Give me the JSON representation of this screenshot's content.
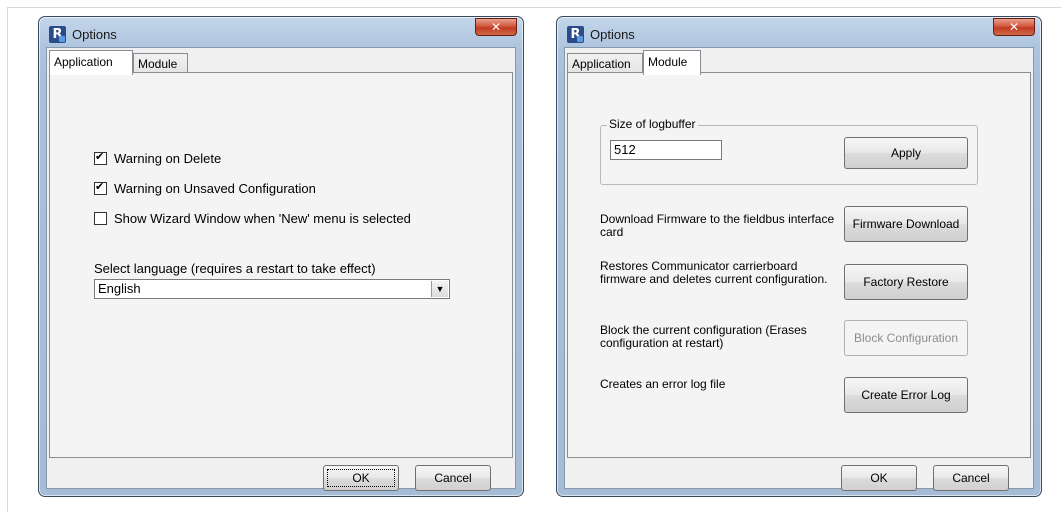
{
  "dialog1": {
    "title": "Options",
    "close_glyph": "✕",
    "tabs": [
      {
        "label": "Application",
        "active": true
      },
      {
        "label": "Module",
        "active": false
      }
    ],
    "checkboxes": [
      {
        "label": "Warning on Delete",
        "checked": true
      },
      {
        "label": "Warning on Unsaved Configuration",
        "checked": true
      },
      {
        "label": "Show Wizard Window when 'New' menu is selected",
        "checked": false
      }
    ],
    "language_label": "Select language (requires a restart to take effect)",
    "language_value": "English",
    "ok_label": "OK",
    "cancel_label": "Cancel"
  },
  "dialog2": {
    "title": "Options",
    "close_glyph": "✕",
    "tabs": [
      {
        "label": "Application",
        "active": false
      },
      {
        "label": "Module",
        "active": true
      }
    ],
    "logbuffer_group_label": "Size of logbuffer",
    "logbuffer_value": "512",
    "apply_label": "Apply",
    "actions": [
      {
        "desc": "Download Firmware to the fieldbus interface card",
        "button": "Firmware Download",
        "enabled": true
      },
      {
        "desc": "Restores Communicator carrierboard firmware and deletes current configuration.",
        "button": "Factory Restore",
        "enabled": true
      },
      {
        "desc": "Block the current configuration (Erases configuration at restart)",
        "button": "Block Configuration",
        "enabled": false
      },
      {
        "desc": "Creates an error log file",
        "button": "Create Error Log",
        "enabled": true
      }
    ],
    "ok_label": "OK",
    "cancel_label": "Cancel"
  },
  "colors": {
    "frame_border": "#3a4a5c",
    "close_button": "#c13c22",
    "client_bg": "#f0f0f0"
  },
  "icons": {
    "app_icon": "app-r-icon",
    "close": "close-icon",
    "dropdown": "chevron-down-icon",
    "check": "checkmark-icon"
  }
}
